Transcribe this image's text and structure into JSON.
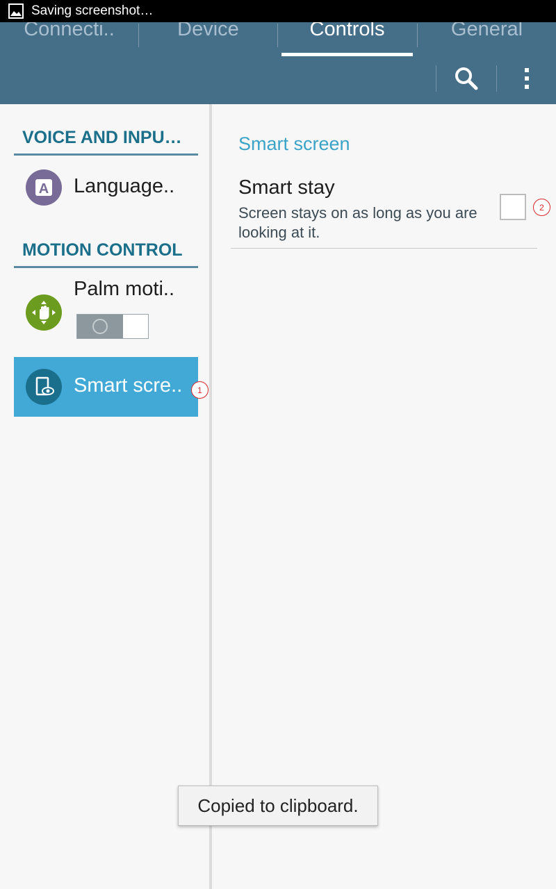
{
  "status_bar": {
    "text": "Saving screenshot…",
    "icon": "image-icon"
  },
  "tabs": [
    {
      "label": "Connecti..",
      "active": false
    },
    {
      "label": "Device",
      "active": false
    },
    {
      "label": "Controls",
      "active": true
    },
    {
      "label": "General",
      "active": false
    }
  ],
  "action_bar": {
    "search_icon": "search-icon",
    "overflow_icon": "more-vert-icon"
  },
  "left_pane": {
    "voice_header": "VOICE AND INPU…",
    "language_label": "Language..",
    "motion_header": "MOTION CONTROL",
    "palm_label": "Palm moti..",
    "palm_toggle_on": false,
    "smart_screen_label": "Smart scre..",
    "badge_1": "1"
  },
  "right_pane": {
    "header": "Smart screen",
    "pref_title": "Smart stay",
    "pref_summary": "Screen stays on as long as you are looking at it.",
    "checked": false,
    "badge_2": "2"
  },
  "toast": "Copied to clipboard.",
  "colors": {
    "action_bar": "#456e89",
    "accent": "#3ba3c8",
    "selected_item": "#42a9d6",
    "section_header": "#1b6f8a",
    "language_icon_bg": "#786b98",
    "palm_icon_bg": "#6b9b1f",
    "smart_icon_bg": "#1a6f8c"
  }
}
